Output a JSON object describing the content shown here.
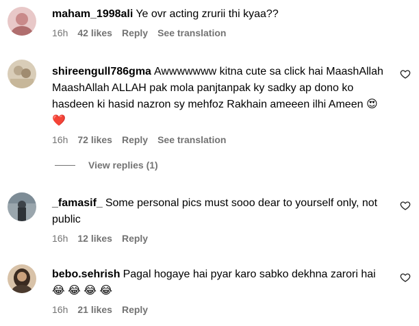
{
  "comments": [
    {
      "username": "maham_1998ali",
      "text": "Ye ovr acting zrurii thi kyaa??",
      "time": "16h",
      "likes": "42 likes",
      "reply": "Reply",
      "translate": "See translation",
      "avatar_color": "#c98a8a"
    },
    {
      "username": "shireengull786gma",
      "text": "Awwwwwww kitna cute sa click hai MaashAllah MaashAllah ALLAH pak mola panjtanpak ky sadky ap dono ko hasdeen ki hasid nazron sy mehfoz Rakhain ameeen ilhi Ameen",
      "emoji": "😍 ❤️",
      "time": "16h",
      "likes": "72 likes",
      "reply": "Reply",
      "translate": "See translation",
      "avatar_color": "#b9a88e"
    },
    {
      "username": "_famasif_",
      "text": "Some personal pics must sooo dear to yourself only, not public",
      "time": "16h",
      "likes": "12 likes",
      "reply": "Reply",
      "avatar_color": "#6b7a83"
    },
    {
      "username": "bebo.sehrish",
      "text": "Pagal hogaye hai pyar karo sabko dekhna zarori hai",
      "emoji": "😂 😂 😂 😂",
      "time": "16h",
      "likes": "21 likes",
      "reply": "Reply",
      "avatar_color": "#4a3a2e"
    }
  ],
  "view_replies": "View replies (1)",
  "colors": {
    "secondary_text": "#737373",
    "primary_text": "#000000",
    "background": "#ffffff"
  },
  "icons": {
    "like": "heart-outline-icon"
  }
}
